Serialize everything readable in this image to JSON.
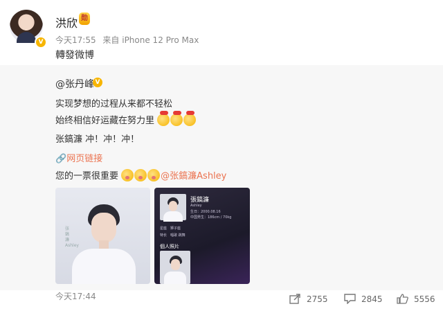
{
  "post": {
    "author": "洪欣",
    "author_badge": "勋",
    "verified_mark": "V",
    "time": "今天17:55",
    "source": "来自 iPhone 12 Pro Max",
    "text": "轉發微博"
  },
  "repost": {
    "original_author": "@张丹峰",
    "verified_mark": "V",
    "line1": "实现梦想的过程从来都不轻松",
    "line2": "始终相信好运藏在努力里",
    "line3": "张鎬濂 冲！冲！冲！",
    "link_label": "网页链接",
    "line5": "您的一票很重要",
    "mention": "@张鎬濂Ashley",
    "photo_text": "张鎬濂 Ashley",
    "card": {
      "name": "張鎬濂",
      "en_name": "Ashley",
      "birth": "生日：2000.08.16",
      "height": "中国男生：186cm / 70kg",
      "row1": "星座　狮子座",
      "row2": "特长　唱歌 跳舞",
      "album_label": "個人照片"
    },
    "time": "今天17:44"
  },
  "actions": {
    "repost_count": "2755",
    "comment_count": "2845",
    "like_count": "5556"
  },
  "colors": {
    "link": "#eb7350",
    "badge": "#f7b500"
  }
}
